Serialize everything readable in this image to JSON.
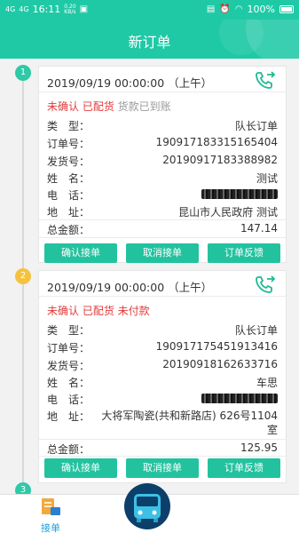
{
  "status_bar": {
    "signal1": "4G",
    "signal2": "4G",
    "time": "16:11",
    "speed": "0.20",
    "speed_unit": "KB/s",
    "battery": "100%"
  },
  "header": {
    "title": "新订单"
  },
  "orders": [
    {
      "index": "1",
      "index_color": "#2ec9a7",
      "date": "2019/09/19 00:00:00 （上午）",
      "status_red": "未确认 已配货",
      "status_extra": "货款已到账",
      "type_label": "类　型：",
      "type_value": "队长订单",
      "order_no_label": "订单号：",
      "order_no": "190917183315165404",
      "ship_no_label": "发货号：",
      "ship_no": "20190917183388982",
      "name_label": "姓　名：",
      "name": "测试",
      "phone_label": "电　话：",
      "address_label": "地　址：",
      "address": "昆山市人民政府 测试",
      "total_label": "总金额：",
      "total": "147.14",
      "buttons": [
        "确认接单",
        "取消接单",
        "订单反馈"
      ]
    },
    {
      "index": "2",
      "index_color": "#f4c23e",
      "date": "2019/09/19 00:00:00 （上午）",
      "status_red": "未确认 已配货 未付款",
      "status_extra": "",
      "type_label": "类　型：",
      "type_value": "队长订单",
      "order_no_label": "订单号：",
      "order_no": "190917175451913416",
      "ship_no_label": "发货号：",
      "ship_no": "20190918162633716",
      "name_label": "姓　名：",
      "name": "车思",
      "phone_label": "电　话：",
      "address_label": "地　址：",
      "address": "大将军陶瓷(共和新路店) 626号1104室",
      "total_label": "总金额：",
      "total": "125.95",
      "buttons": [
        "确认接单",
        "取消接单",
        "订单反馈"
      ]
    }
  ],
  "third_node": "3",
  "tabbar": {
    "tab1_label": "接单"
  },
  "colors": {
    "accent": "#1fc9a6",
    "button": "#22c29f",
    "status_red": "#e23b3b"
  }
}
